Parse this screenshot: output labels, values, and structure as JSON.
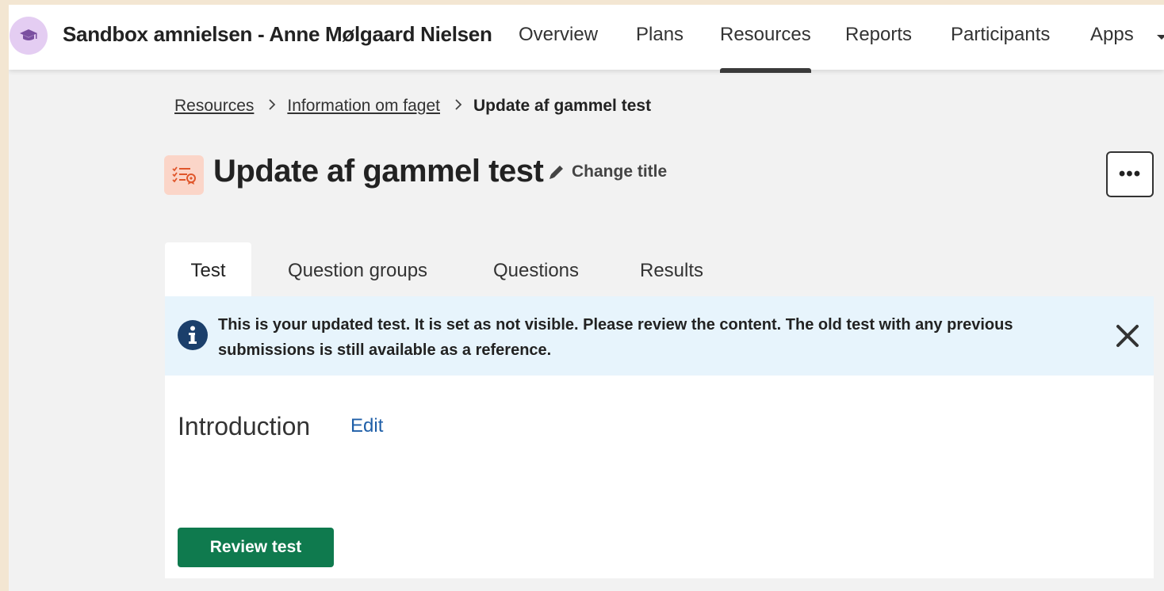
{
  "header": {
    "course_title": "Sandbox amnielsen - Anne Mølgaard Nielsen",
    "course_icon": "graduation-cap-icon",
    "nav": [
      {
        "label": "Overview"
      },
      {
        "label": "Plans"
      },
      {
        "label": "Resources",
        "active": true
      },
      {
        "label": "Reports"
      },
      {
        "label": "Participants"
      },
      {
        "label": "Apps"
      }
    ]
  },
  "breadcrumb": {
    "items": [
      "Resources",
      "Information om faget"
    ],
    "current": "Update af gammel test"
  },
  "page": {
    "title": "Update af gammel test",
    "icon": "test-checklist-icon",
    "change_title_label": "Change title",
    "more_label": "•••"
  },
  "tabs": [
    {
      "label": "Test",
      "active": true
    },
    {
      "label": "Question groups"
    },
    {
      "label": "Questions"
    },
    {
      "label": "Results"
    }
  ],
  "alert": {
    "text": "This is your updated test. It is set as not visible. Please review the content. The old test with any previous submissions is still available as a reference.",
    "icon": "info-icon"
  },
  "content": {
    "intro_heading": "Introduction",
    "edit_label": "Edit",
    "review_button_label": "Review test"
  },
  "colors": {
    "accent_green": "#0f7a4e",
    "link_blue": "#1f5fa8",
    "alert_bg": "#e7f4fc",
    "icon_orange": "#e0562b",
    "avatar_purple": "#e4cdf2"
  }
}
